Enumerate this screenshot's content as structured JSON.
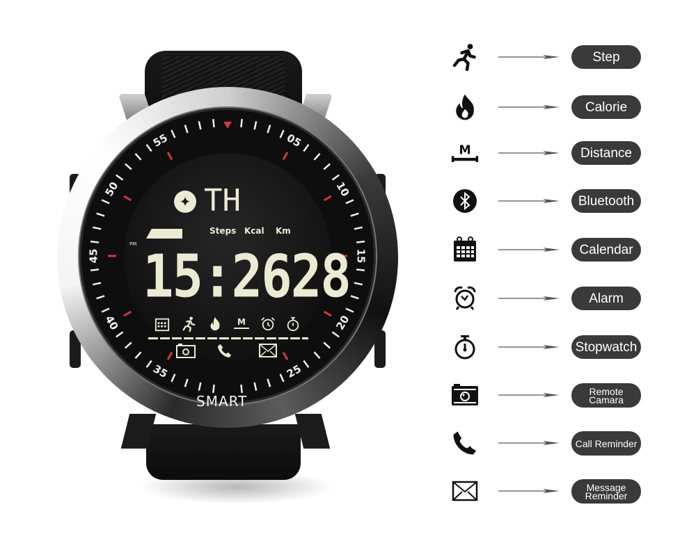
{
  "watch": {
    "brand_label": "SMART",
    "display": {
      "day": "TH",
      "time": "15:2628",
      "meridiem": "PM",
      "units": [
        "Steps",
        "Kcal",
        "Km"
      ],
      "status_icons": [
        "calendar-icon",
        "runner-icon",
        "flame-icon",
        "distance-icon",
        "alarm-icon",
        "stopwatch-icon"
      ],
      "bottom_icons": [
        "camera-icon",
        "phone-icon",
        "envelope-icon"
      ]
    },
    "bezel_numbers": [
      "05",
      "10",
      "15",
      "20",
      "25",
      "35",
      "40",
      "45",
      "50",
      "55"
    ],
    "accent_color": "#d23a3a",
    "lcd_color": "#e9ebd3"
  },
  "features": [
    {
      "icon": "runner-icon",
      "label": "Step"
    },
    {
      "icon": "flame-icon",
      "label": "Calorie"
    },
    {
      "icon": "distance-icon",
      "label": "Distance"
    },
    {
      "icon": "bluetooth-icon",
      "label": "Bluetooth"
    },
    {
      "icon": "calendar-icon",
      "label": "Calendar"
    },
    {
      "icon": "alarm-icon",
      "label": "Alarm"
    },
    {
      "icon": "stopwatch-icon",
      "label": "Stopwatch"
    },
    {
      "icon": "camera-icon",
      "label": "Remote Camara"
    },
    {
      "icon": "phone-icon",
      "label": "Call Reminder"
    },
    {
      "icon": "envelope-icon",
      "label": "Message Reminder"
    }
  ],
  "colors": {
    "pill_background": "#3a3a3a",
    "pill_text": "#ffffff",
    "arrow": "#555555"
  }
}
